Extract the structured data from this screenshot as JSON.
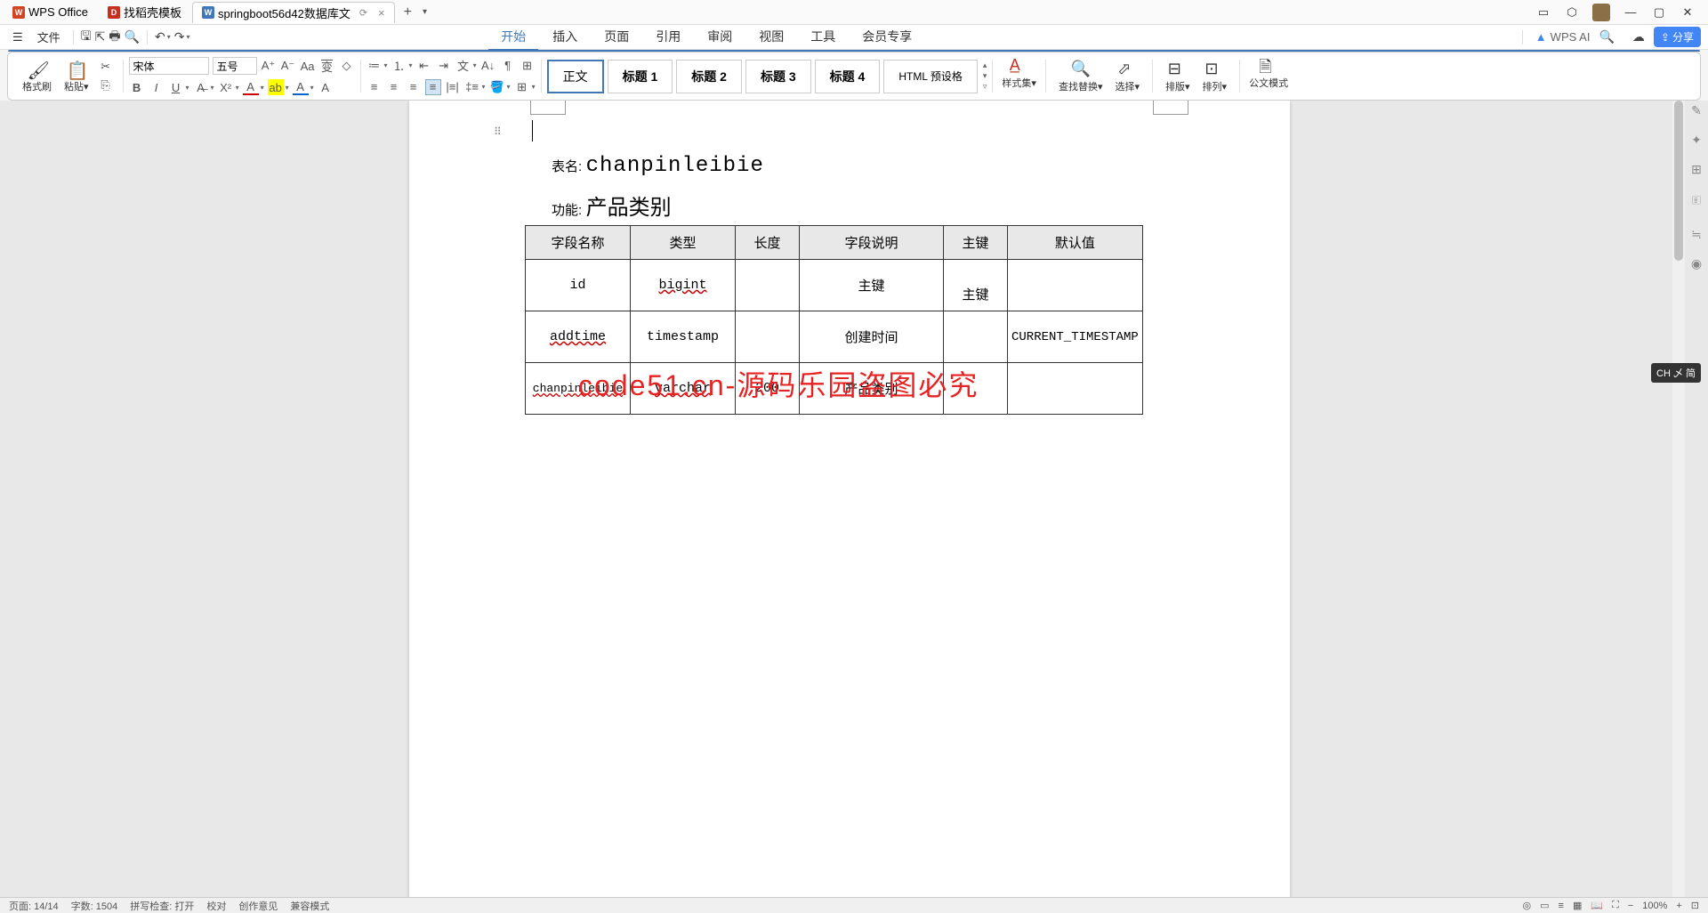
{
  "tabs": {
    "wps": "WPS Office",
    "docer": "找稻壳模板",
    "doc": "springboot56d42数据库文",
    "sync": "⟳"
  },
  "menu": {
    "file": "文件",
    "tabs": [
      "开始",
      "插入",
      "页面",
      "引用",
      "审阅",
      "视图",
      "工具",
      "会员专享"
    ],
    "activeIndex": 0,
    "wpsai": "WPS AI",
    "share": "分享"
  },
  "ribbon": {
    "formatBrush": "格式刷",
    "paste": "粘贴",
    "font": "宋体",
    "size": "五号",
    "bold": "B",
    "italic": "I",
    "underline": "U",
    "styles": {
      "normal": "正文",
      "h1": "标题 1",
      "h2": "标题 2",
      "h3": "标题 3",
      "h4": "标题 4",
      "html": "HTML 预设格"
    },
    "styleset": "样式集",
    "findreplace": "查找替换",
    "select": "选择",
    "sort": "排版",
    "arrange": "排列",
    "docmode": "公文模式"
  },
  "document": {
    "tableNameLabel": "表名:",
    "tableName": "chanpinleibie",
    "funcLabel": "功能:",
    "funcValue": "产品类别",
    "headers": [
      "字段名称",
      "类型",
      "长度",
      "字段说明",
      "主键",
      "默认值"
    ],
    "rows": [
      {
        "field": "id",
        "type": "bigint",
        "length": "",
        "desc": "主键",
        "pk": "主键",
        "default": ""
      },
      {
        "field": "addtime",
        "type": "timestamp",
        "length": "",
        "desc": "创建时间",
        "pk": "",
        "default": "CURRENT_TIMESTAMP"
      },
      {
        "field": "chanpinleibie",
        "type": "varchar",
        "length": "200",
        "desc": "产品类别",
        "pk": "",
        "default": ""
      }
    ],
    "watermark": "code51.cn-源码乐园盗图必究"
  },
  "ime": "CH 乄 简",
  "status": {
    "page": "页面: 14/14",
    "words": "字数: 1504",
    "spell": "拼写检查: 打开",
    "check": "校对",
    "advice": "创作意见",
    "mode": "兼容模式",
    "zoom": "100%"
  }
}
